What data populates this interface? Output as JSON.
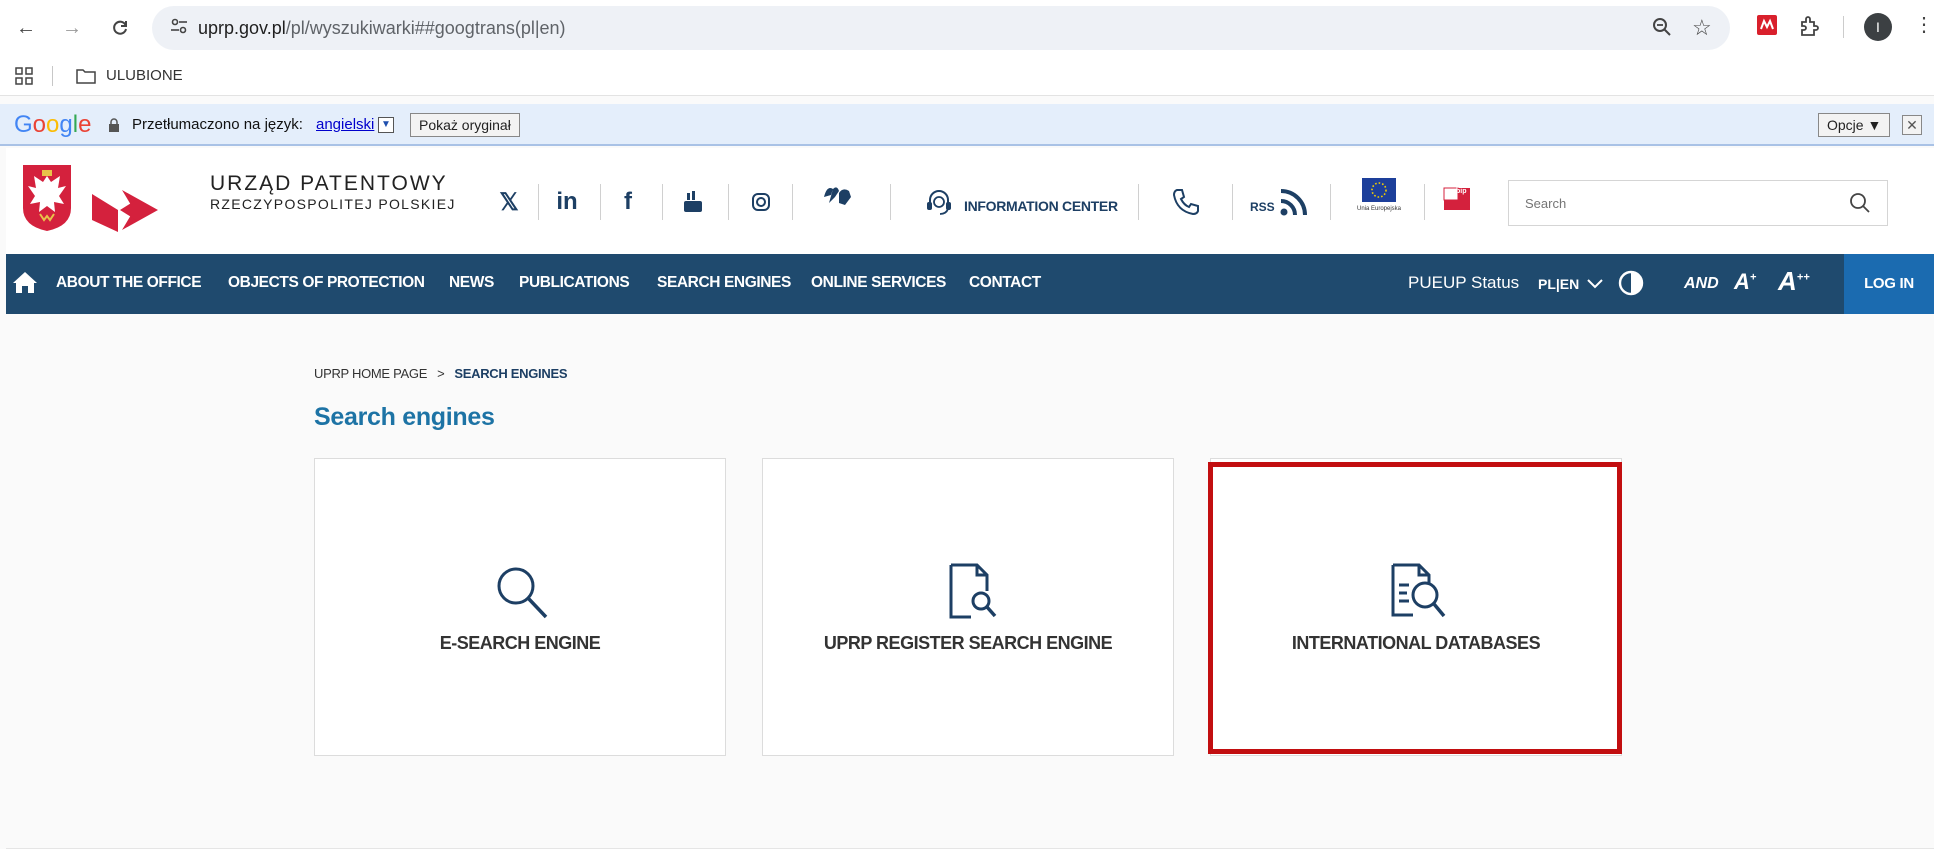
{
  "browser": {
    "url_host": "uprp.gov.pl",
    "url_path": "/pl/wyszukiwarki##googtrans(pl|en)",
    "profile_initial": "I"
  },
  "bookmarks": {
    "folder_label": "ULUBIONE"
  },
  "translate_bar": {
    "logo": "Google",
    "translated_to": "Przetłumaczono na język:",
    "language": "angielski",
    "show_original": "Pokaż oryginał",
    "options": "Opcje ▼",
    "close": "✕"
  },
  "header": {
    "logo_line1": "URZĄD PATENTOWY",
    "logo_line2": "RZECZYPOSPOLITEJ POLSKIEJ",
    "social": {
      "x": "𝕏",
      "linkedin": "in",
      "facebook": "f"
    },
    "information_center": "INFORMATION CENTER",
    "rss": "RSS",
    "eu_label": "Unia Europejska",
    "bip_label": "bip",
    "search_placeholder": "Search"
  },
  "nav": {
    "items": [
      {
        "label": "ABOUT THE OFFICE"
      },
      {
        "label": "OBJECTS OF PROTECTION"
      },
      {
        "label": "NEWS"
      },
      {
        "label": "PUBLICATIONS"
      },
      {
        "label": "SEARCH ENGINES"
      },
      {
        "label": "ONLINE SERVICES"
      },
      {
        "label": "CONTACT"
      }
    ],
    "pueup_status": "PUEUP Status",
    "language": "PL|EN",
    "font_and": "AND",
    "font_a_plus": "A",
    "font_a_plusplus": "A",
    "login": "LOG IN"
  },
  "breadcrumb": {
    "home": "UPRP HOME PAGE",
    "separator": ">",
    "current": "SEARCH ENGINES"
  },
  "main": {
    "title": "Search engines",
    "cards": [
      {
        "label": "E-SEARCH ENGINE",
        "icon": "search-icon"
      },
      {
        "label": "UPRP REGISTER SEARCH ENGINE",
        "icon": "document-search-icon"
      },
      {
        "label": "INTERNATIONAL DATABASES",
        "icon": "database-search-icon"
      }
    ]
  },
  "colors": {
    "nav_bg": "#1f4a6e",
    "login_bg": "#1b6bb0",
    "title": "#1d73a5",
    "highlight": "#c20e10"
  }
}
